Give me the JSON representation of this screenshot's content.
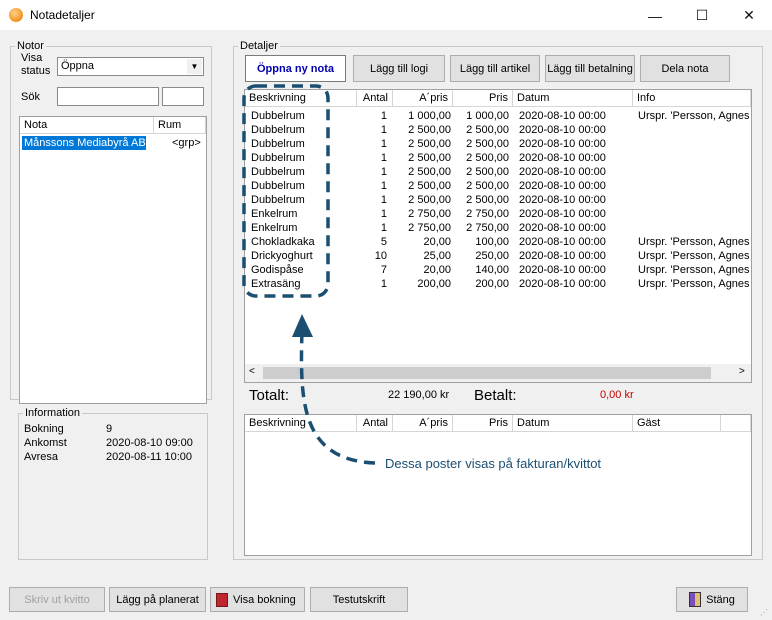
{
  "window": {
    "title": "Notadetaljer",
    "controls": {
      "minimize": "—",
      "maximize": "☐",
      "close": "✕"
    }
  },
  "notor": {
    "legend": "Notor",
    "visa_status_label_line1": "Visa",
    "visa_status_label_line2": "status",
    "visa_status_value": "Öppna",
    "sok_label": "Sök",
    "columns": [
      "Nota",
      "Rum"
    ],
    "items": [
      {
        "nota": "Månssons Mediabyrå AB",
        "rum": "<grp>"
      }
    ]
  },
  "information": {
    "legend": "Information",
    "rows": [
      {
        "label": "Bokning",
        "value": "9"
      },
      {
        "label": "Ankomst",
        "value": "2020-08-10 09:00"
      },
      {
        "label": "Avresa",
        "value": "2020-08-11 10:00"
      }
    ]
  },
  "detaljer": {
    "legend": "Detaljer",
    "tabs": {
      "active": "Öppna ny nota"
    },
    "buttons": [
      "Lägg till logi",
      "Lägg till artikel",
      "Lägg till betalning",
      "Dela nota"
    ],
    "columns": [
      "Beskrivning",
      "Antal",
      "A´pris",
      "Pris",
      "Datum",
      "Info"
    ],
    "rows": [
      [
        "Dubbelrum",
        "1",
        "1 000,00",
        "1 000,00",
        "2020-08-10 00:00",
        "Urspr. 'Persson, Agnes ("
      ],
      [
        "Dubbelrum",
        "1",
        "2 500,00",
        "2 500,00",
        "2020-08-10 00:00",
        ""
      ],
      [
        "Dubbelrum",
        "1",
        "2 500,00",
        "2 500,00",
        "2020-08-10 00:00",
        ""
      ],
      [
        "Dubbelrum",
        "1",
        "2 500,00",
        "2 500,00",
        "2020-08-10 00:00",
        ""
      ],
      [
        "Dubbelrum",
        "1",
        "2 500,00",
        "2 500,00",
        "2020-08-10 00:00",
        ""
      ],
      [
        "Dubbelrum",
        "1",
        "2 500,00",
        "2 500,00",
        "2020-08-10 00:00",
        ""
      ],
      [
        "Dubbelrum",
        "1",
        "2 500,00",
        "2 500,00",
        "2020-08-10 00:00",
        ""
      ],
      [
        "Enkelrum",
        "1",
        "2 750,00",
        "2 750,00",
        "2020-08-10 00:00",
        ""
      ],
      [
        "Enkelrum",
        "1",
        "2 750,00",
        "2 750,00",
        "2020-08-10 00:00",
        ""
      ],
      [
        "Chokladkaka",
        "5",
        "20,00",
        "100,00",
        "2020-08-10 00:00",
        "Urspr. 'Persson, Agnes ("
      ],
      [
        "Drickyoghurt",
        "10",
        "25,00",
        "250,00",
        "2020-08-10 00:00",
        "Urspr. 'Persson, Agnes ("
      ],
      [
        "Godispåse",
        "7",
        "20,00",
        "140,00",
        "2020-08-10 00:00",
        "Urspr. 'Persson, Agnes ("
      ],
      [
        "Extrasäng",
        "1",
        "200,00",
        "200,00",
        "2020-08-10 00:00",
        "Urspr. 'Persson, Agnes ("
      ]
    ],
    "totalt_label": "Totalt:",
    "totalt_value": "22 190,00 kr",
    "betalt_label": "Betalt:",
    "betalt_value": "0,00 kr",
    "lower_columns": [
      "Beskrivning",
      "Antal",
      "A´pris",
      "Pris",
      "Datum",
      "Gäst"
    ]
  },
  "annotation": {
    "text": "Dessa poster visas på fakturan/kvittot",
    "color": "#1b4f72"
  },
  "footer": {
    "skriv_ut": "Skriv ut kvitto",
    "lagg_pa": "Lägg på planerat",
    "visa_bokning": "Visa bokning",
    "testutskrift": "Testutskrift",
    "stang": "Stäng"
  }
}
